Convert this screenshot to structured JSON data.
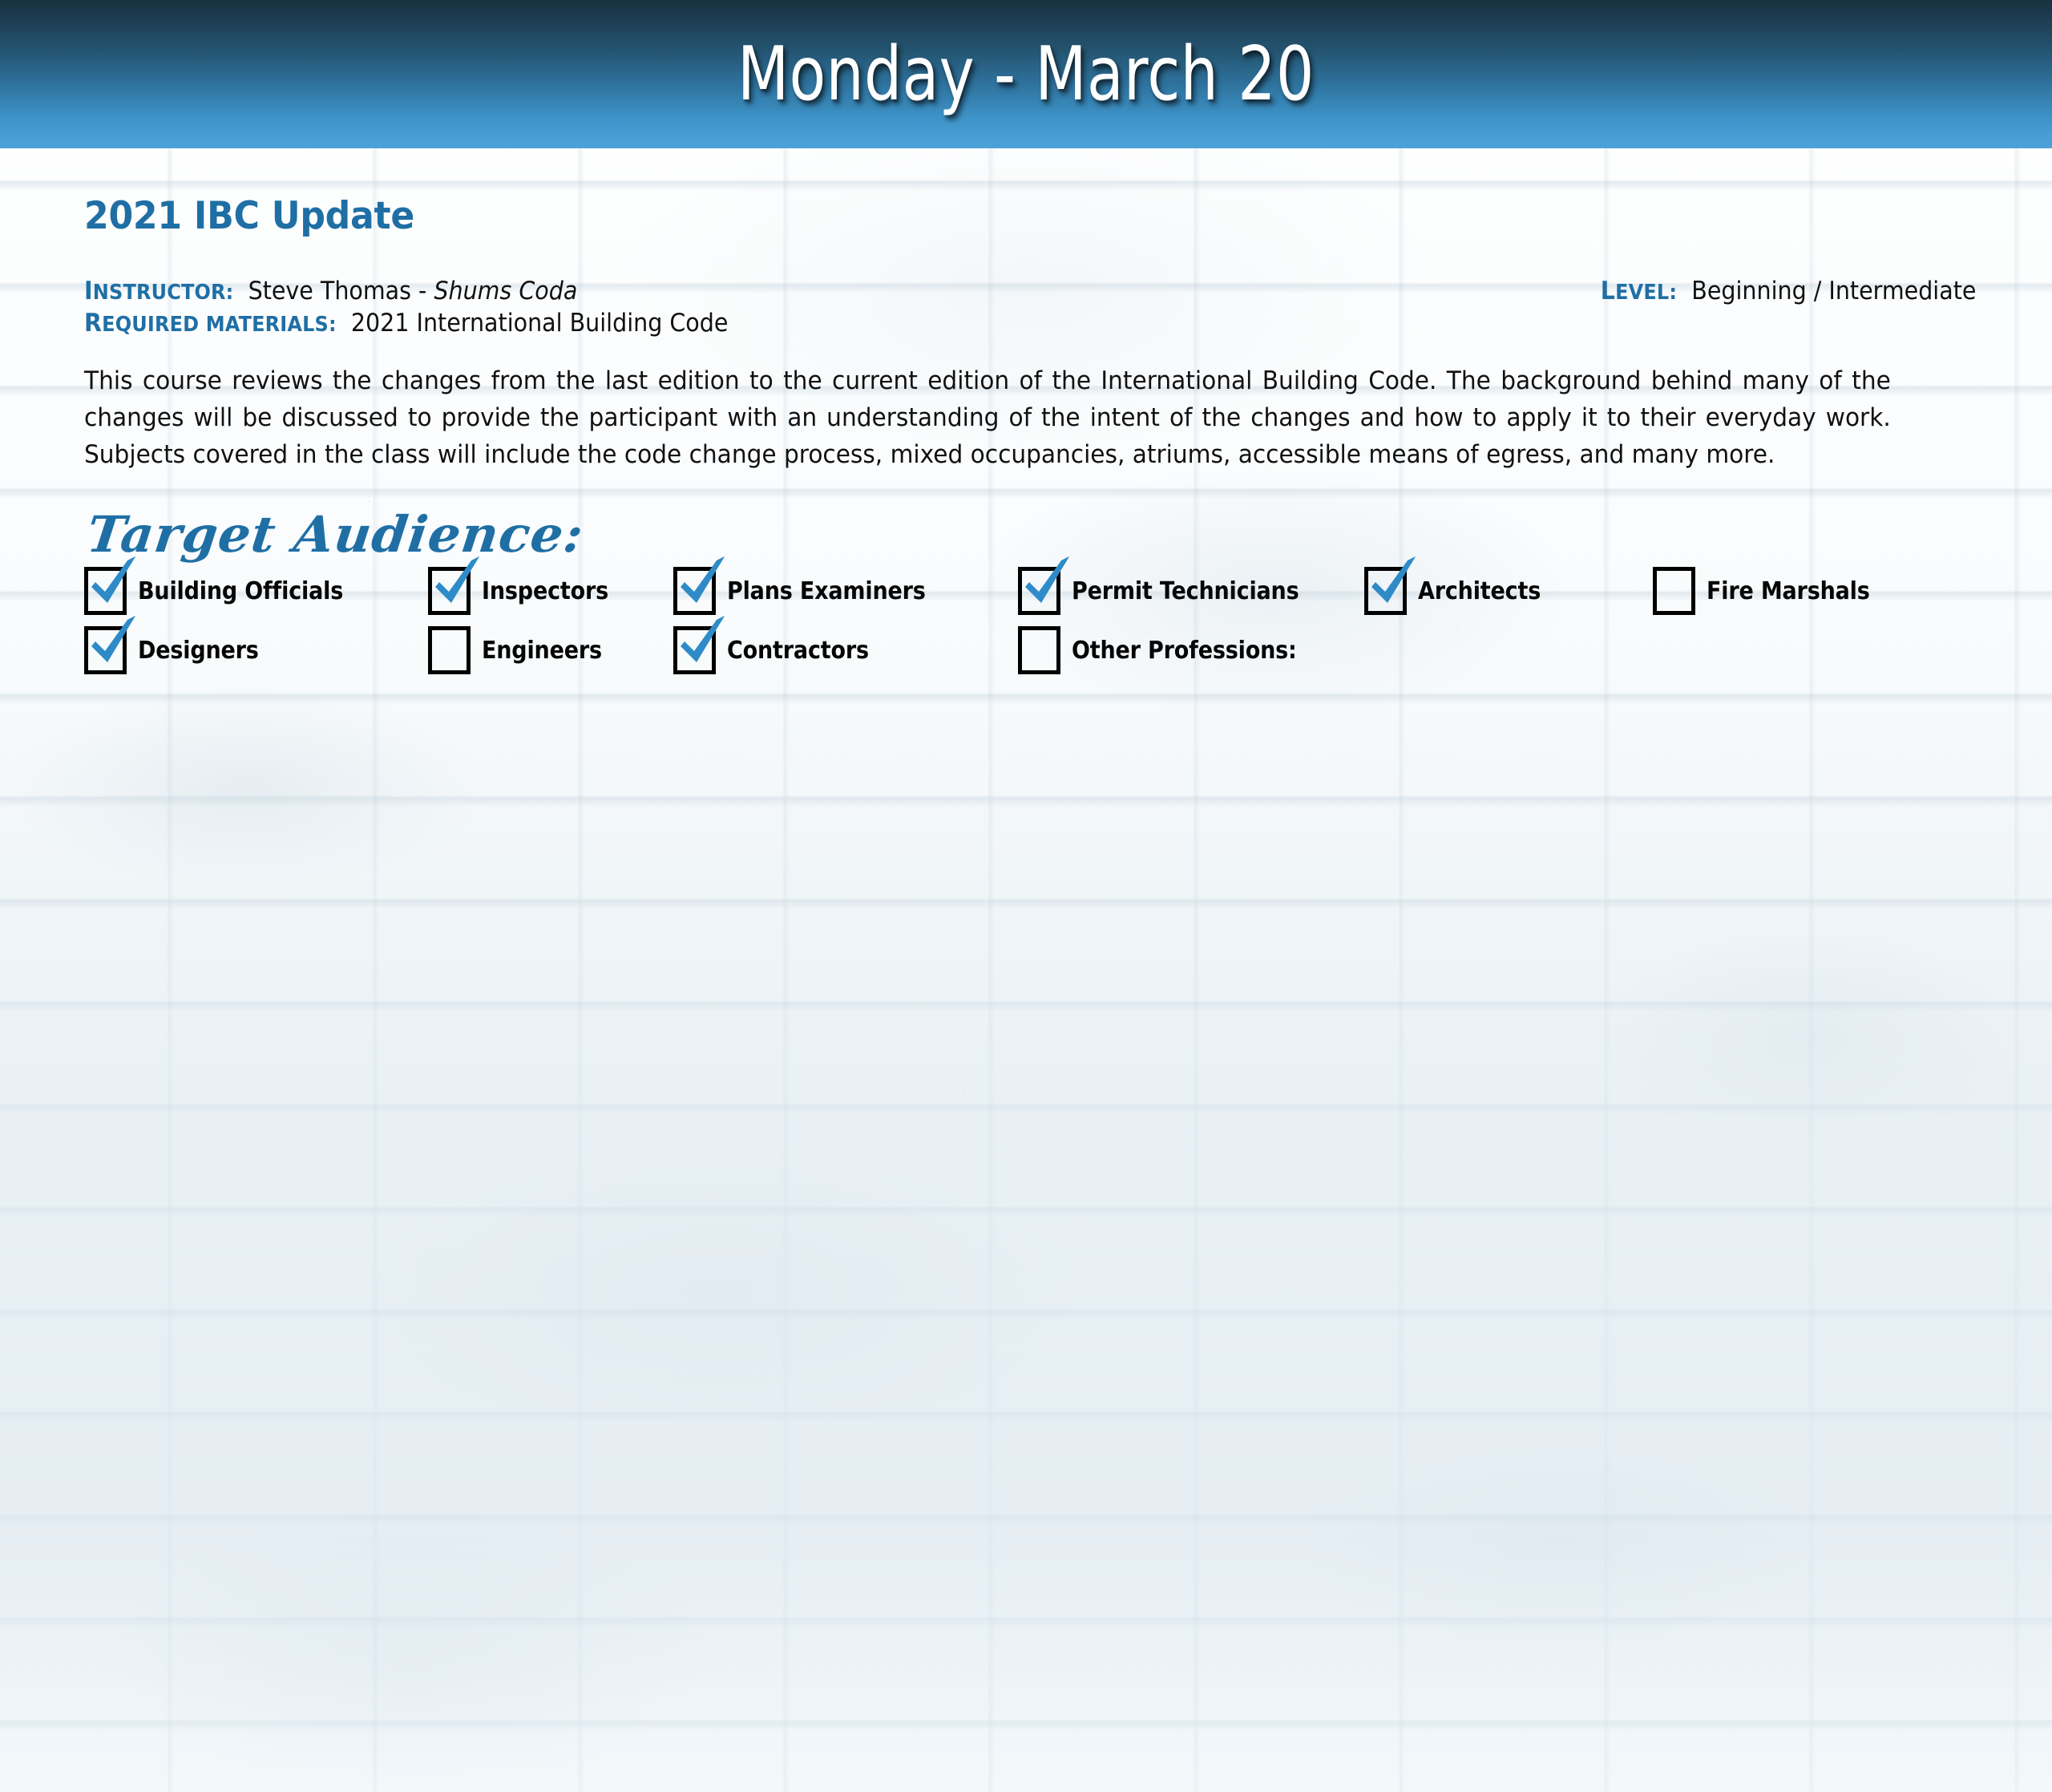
{
  "header": {
    "title": "Monday - March 20",
    "gradient_top": "#1c3a4e",
    "gradient_bottom": "#4ba2d8"
  },
  "course": {
    "title": "2021 IBC Update",
    "accent_color": "#1f6fa5",
    "instructor_label": "INSTRUCTOR:",
    "instructor_label_cap": "I",
    "instructor_label_rest": "NSTRUCTOR:",
    "instructor_name": "Steve Thomas - ",
    "instructor_company": "Shums Coda",
    "materials_label_cap": "R",
    "materials_label_rest": "EQUIRED MATERIALS:",
    "materials_value": "2021 International Building Code",
    "level_label_cap": "L",
    "level_label_rest": "EVEL:",
    "level_value": "Beginning / Intermediate",
    "description": "This course reviews the changes from the last edition to the current edition of the International Building Code. The background behind many of the changes will be discussed to provide the participant with an understanding of the intent of the changes and how to apply it to their everyday work. Subjects covered in the class will include the code change process, mixed occupancies, atriums, accessible means of egress, and many more."
  },
  "audience": {
    "heading": "Target Audience:",
    "check_color": "#2e8bc8",
    "items": [
      {
        "label": "Building Officials",
        "checked": true,
        "col": 0,
        "row": 0
      },
      {
        "label": "Inspectors",
        "checked": true,
        "col": 1,
        "row": 0
      },
      {
        "label": "Plans Examiners",
        "checked": true,
        "col": 2,
        "row": 0
      },
      {
        "label": "Permit Technicians",
        "checked": true,
        "col": 3,
        "row": 0
      },
      {
        "label": "Architects",
        "checked": true,
        "col": 4,
        "row": 0
      },
      {
        "label": "Fire Marshals",
        "checked": false,
        "col": 5,
        "row": 0
      },
      {
        "label": "Designers",
        "checked": true,
        "col": 0,
        "row": 1
      },
      {
        "label": "Engineers",
        "checked": false,
        "col": 1,
        "row": 1
      },
      {
        "label": "Contractors",
        "checked": true,
        "col": 2,
        "row": 1
      },
      {
        "label": "Other Professions:",
        "checked": false,
        "col": 3,
        "row": 1
      }
    ],
    "column_x": [
      103,
      532,
      838,
      1268,
      1700,
      2060
    ],
    "row_y": [
      0,
      74
    ]
  }
}
